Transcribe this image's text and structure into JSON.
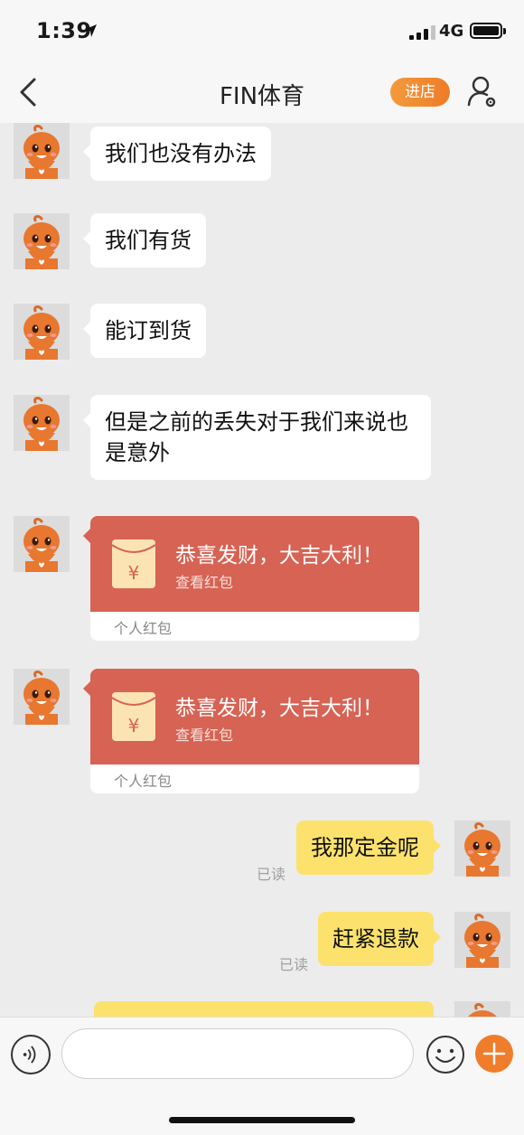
{
  "status_bar": {
    "time": "1:39",
    "network": "4G"
  },
  "nav": {
    "title": "FIN体育",
    "enter_label": "进店"
  },
  "messages": [
    {
      "text": "我们也没有办法"
    },
    {
      "text": "我们有货"
    },
    {
      "text": "能订到货"
    },
    {
      "text": "但是之前的丢失对于我们来说也是意外"
    }
  ],
  "red_packets": [
    {
      "title": "恭喜发财，大吉大利！",
      "action": "查看红包",
      "label": "个人红包"
    },
    {
      "title": "恭喜发财，大吉大利！",
      "action": "查看红包",
      "label": "个人红包"
    }
  ],
  "my_messages": [
    {
      "text": "我那定金呢",
      "status": "已读"
    },
    {
      "text": "赶紧退款",
      "status": "已读"
    }
  ],
  "input": {
    "placeholder": ""
  },
  "colors": {
    "accent": "#ef7d2b",
    "red_packet": "#d66354",
    "my_bubble": "#fce26d",
    "chat_bg": "#ececec"
  }
}
